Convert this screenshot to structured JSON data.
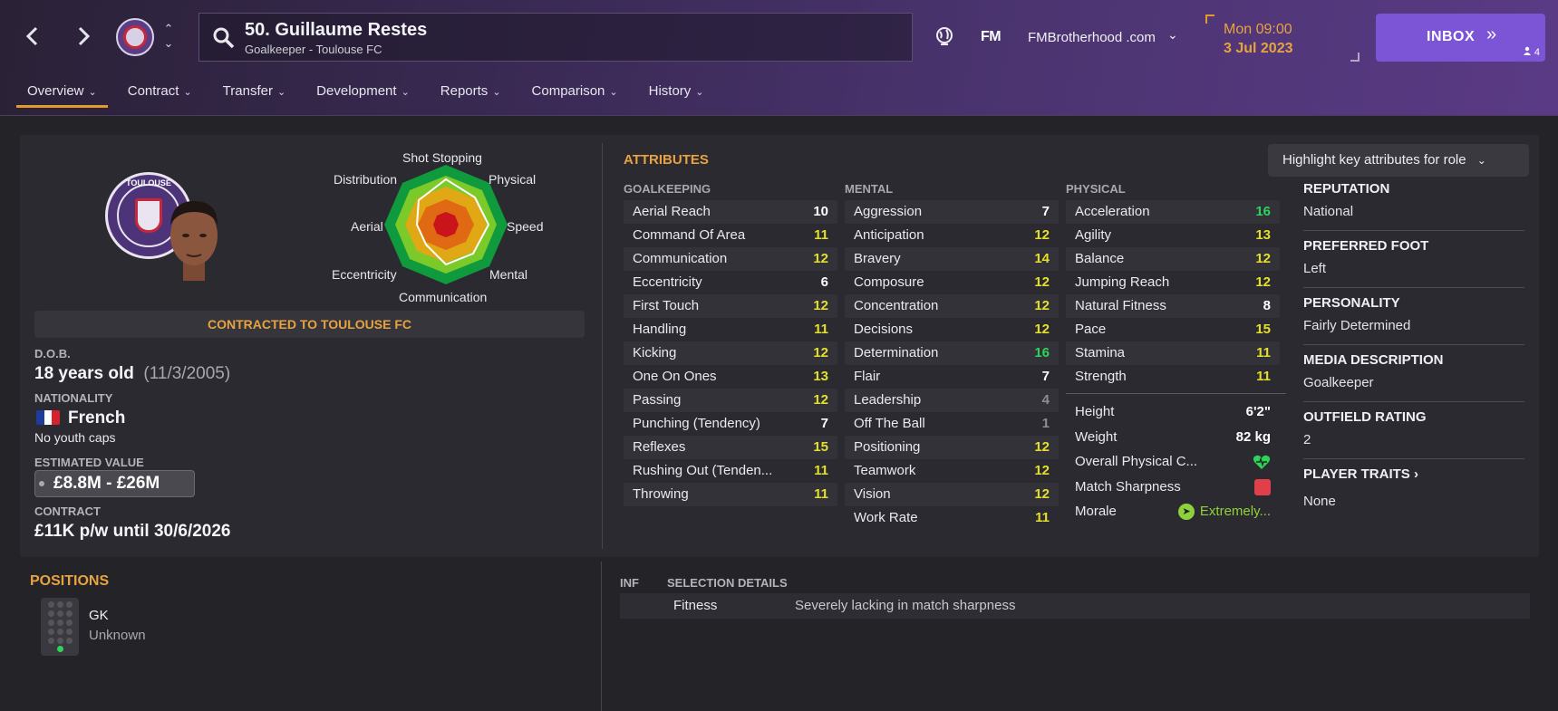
{
  "header": {
    "player_title": "50. Guillaume Restes",
    "player_sub": "Goalkeeper - Toulouse FC",
    "fm_logo": "FM",
    "site": "FMBrotherhood .com",
    "time": "Mon 09:00",
    "date": "3 Jul 2023",
    "inbox_label": "INBOX",
    "inbox_count": "4"
  },
  "tabs": [
    {
      "label": "Overview"
    },
    {
      "label": "Contract"
    },
    {
      "label": "Transfer"
    },
    {
      "label": "Development"
    },
    {
      "label": "Reports"
    },
    {
      "label": "Comparison"
    },
    {
      "label": "History"
    }
  ],
  "radar": {
    "labels": [
      "Shot Stopping",
      "Physical",
      "Speed",
      "Mental",
      "Communication",
      "Eccentricity",
      "Aerial",
      "Distribution"
    ]
  },
  "club_text": "TOULOUSE",
  "profile": {
    "contract_status": "CONTRACTED TO TOULOUSE FC",
    "dob_label": "D.O.B.",
    "age": "18 years old",
    "dob": "(11/3/2005)",
    "nationality_label": "NATIONALITY",
    "nationality": "French",
    "youth_caps": "No youth caps",
    "value_label": "ESTIMATED VALUE",
    "value": "£8.8M - £26M",
    "contract_label": "CONTRACT",
    "contract": "£11K p/w until 30/6/2026"
  },
  "attributes": {
    "title": "ATTRIBUTES",
    "highlight_label": "Highlight key attributes for role",
    "goalkeeping_head": "GOALKEEPING",
    "mental_head": "MENTAL",
    "physical_head": "PHYSICAL",
    "goalkeeping": [
      {
        "name": "Aerial Reach",
        "value": "10",
        "tone": "w"
      },
      {
        "name": "Command Of Area",
        "value": "11",
        "tone": "y"
      },
      {
        "name": "Communication",
        "value": "12",
        "tone": "y"
      },
      {
        "name": "Eccentricity",
        "value": "6",
        "tone": "w"
      },
      {
        "name": "First Touch",
        "value": "12",
        "tone": "y"
      },
      {
        "name": "Handling",
        "value": "11",
        "tone": "y"
      },
      {
        "name": "Kicking",
        "value": "12",
        "tone": "y"
      },
      {
        "name": "One On Ones",
        "value": "13",
        "tone": "y"
      },
      {
        "name": "Passing",
        "value": "12",
        "tone": "y"
      },
      {
        "name": "Punching (Tendency)",
        "value": "7",
        "tone": "w"
      },
      {
        "name": "Reflexes",
        "value": "15",
        "tone": "y"
      },
      {
        "name": "Rushing Out (Tenden...",
        "value": "11",
        "tone": "y"
      },
      {
        "name": "Throwing",
        "value": "11",
        "tone": "y"
      }
    ],
    "mental": [
      {
        "name": "Aggression",
        "value": "7",
        "tone": "w"
      },
      {
        "name": "Anticipation",
        "value": "12",
        "tone": "y"
      },
      {
        "name": "Bravery",
        "value": "14",
        "tone": "y"
      },
      {
        "name": "Composure",
        "value": "12",
        "tone": "y"
      },
      {
        "name": "Concentration",
        "value": "12",
        "tone": "y"
      },
      {
        "name": "Decisions",
        "value": "12",
        "tone": "y"
      },
      {
        "name": "Determination",
        "value": "16",
        "tone": "g"
      },
      {
        "name": "Flair",
        "value": "7",
        "tone": "w"
      },
      {
        "name": "Leadership",
        "value": "4",
        "tone": "grey"
      },
      {
        "name": "Off The Ball",
        "value": "1",
        "tone": "grey"
      },
      {
        "name": "Positioning",
        "value": "12",
        "tone": "y"
      },
      {
        "name": "Teamwork",
        "value": "12",
        "tone": "y"
      },
      {
        "name": "Vision",
        "value": "12",
        "tone": "y"
      },
      {
        "name": "Work Rate",
        "value": "11",
        "tone": "y"
      }
    ],
    "physical": [
      {
        "name": "Acceleration",
        "value": "16",
        "tone": "g"
      },
      {
        "name": "Agility",
        "value": "13",
        "tone": "y"
      },
      {
        "name": "Balance",
        "value": "12",
        "tone": "y"
      },
      {
        "name": "Jumping Reach",
        "value": "12",
        "tone": "y"
      },
      {
        "name": "Natural Fitness",
        "value": "8",
        "tone": "w"
      },
      {
        "name": "Pace",
        "value": "15",
        "tone": "y"
      },
      {
        "name": "Stamina",
        "value": "11",
        "tone": "y"
      },
      {
        "name": "Strength",
        "value": "11",
        "tone": "y"
      }
    ],
    "extra": {
      "height_label": "Height",
      "height": "6'2\"",
      "weight_label": "Weight",
      "weight": "82 kg",
      "opc_label": "Overall Physical C...",
      "sharpness_label": "Match Sharpness",
      "morale_label": "Morale",
      "morale": "Extremely..."
    }
  },
  "info": {
    "reputation_label": "REPUTATION",
    "reputation": "National",
    "foot_label": "PREFERRED FOOT",
    "foot": "Left",
    "personality_label": "PERSONALITY",
    "personality": "Fairly Determined",
    "media_label": "MEDIA DESCRIPTION",
    "media": "Goalkeeper",
    "outfield_label": "OUTFIELD RATING",
    "outfield": "2",
    "traits_label": "PLAYER TRAITS",
    "traits": "None"
  },
  "positions": {
    "title": "POSITIONS",
    "code": "GK",
    "level": "Unknown"
  },
  "selection": {
    "inf_head": "INF",
    "details_head": "SELECTION DETAILS",
    "row_label": "Fitness",
    "row_value": "Severely lacking in match sharpness"
  },
  "colors": {
    "accent": "#e8a340",
    "inbox": "#7b55d6",
    "good": "#2ed35a",
    "mid": "#e4e02a"
  }
}
